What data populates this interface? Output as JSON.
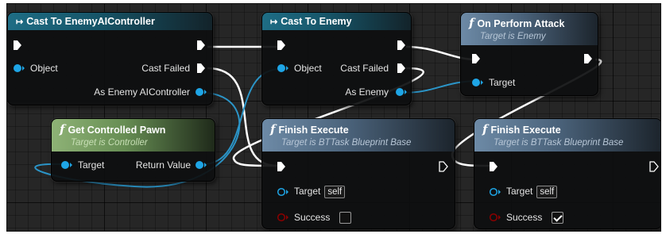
{
  "colors": {
    "exec": "#ffffff",
    "object_pin": "#1ea5e6",
    "bool_pin": "#8c0000",
    "wire_object": "#2b95c8",
    "wire_exec": "#ffffff"
  },
  "nodes": {
    "cast_ai": {
      "title": "Cast To EnemyAIController",
      "pins": {
        "object": "Object",
        "cast_failed": "Cast Failed",
        "as_output": "As Enemy AIController"
      }
    },
    "cast_enemy": {
      "title": "Cast To Enemy",
      "pins": {
        "object": "Object",
        "cast_failed": "Cast Failed",
        "as_output": "As Enemy"
      }
    },
    "perform_attack": {
      "title": "On Perform Attack",
      "subtitle": "Target is Enemy",
      "pins": {
        "target": "Target"
      }
    },
    "get_pawn": {
      "title": "Get Controlled Pawn",
      "subtitle": "Target is Controller",
      "pins": {
        "target": "Target",
        "return_value": "Return Value"
      }
    },
    "finish_1": {
      "title": "Finish Execute",
      "subtitle": "Target is BTTask Blueprint Base",
      "pins": {
        "target": "Target",
        "target_default": "self",
        "success": "Success",
        "success_checked": false
      }
    },
    "finish_2": {
      "title": "Finish Execute",
      "subtitle": "Target is BTTask Blueprint Base",
      "pins": {
        "target": "Target",
        "target_default": "self",
        "success": "Success",
        "success_checked": true
      }
    }
  }
}
